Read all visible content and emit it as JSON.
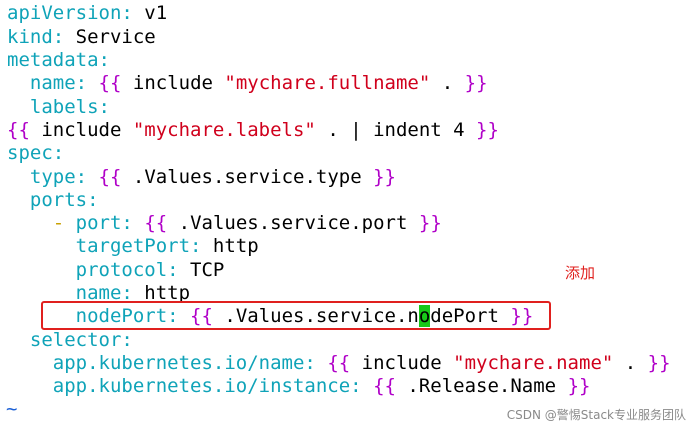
{
  "code": {
    "l1": {
      "k": "apiVersion:",
      "v": " v1"
    },
    "l2": {
      "k": "kind:",
      "v": " Service"
    },
    "l3": {
      "k": "metadata:"
    },
    "l4": {
      "k": "name:",
      "b1": "{{",
      "mid": " include ",
      "s": "\"mychare.fullname\"",
      "tail": " . ",
      "b2": "}}"
    },
    "l5": {
      "k": "labels:"
    },
    "l6": {
      "b1": "{{",
      "mid": " include ",
      "s": "\"mychare.labels\"",
      "tail": " . | indent 4 ",
      "b2": "}}"
    },
    "l7": {
      "k": "spec:"
    },
    "l8": {
      "k": "type:",
      "b1": "{{",
      "mid": " .Values.service.type ",
      "b2": "}}"
    },
    "l9": {
      "k": "ports:"
    },
    "l10": {
      "d": "- ",
      "k": "port:",
      "b1": "{{",
      "mid": " .Values.service.port ",
      "b2": "}}"
    },
    "l11": {
      "k": "targetPort:",
      "v": " http"
    },
    "l12": {
      "k": "protocol:",
      "v": " TCP"
    },
    "l13": {
      "k": "name:",
      "v": " http"
    },
    "l14": {
      "k": "nodePort:",
      "b1": "{{",
      "mid1": " .Values.service.n",
      "cur": "o",
      "mid2": "dePort ",
      "b2": "}}"
    },
    "l15": {
      "k": "selector:"
    },
    "l16": {
      "k": "app.kubernetes.io/name:",
      "b1": "{{",
      "mid": " include ",
      "s": "\"mychare.name\"",
      "tail": " . ",
      "b2": "}}"
    },
    "l17": {
      "k": "app.kubernetes.io/instance:",
      "b1": "{{",
      "mid": " .Release.Name ",
      "b2": "}}"
    },
    "tilde": "~"
  },
  "annotation": "添加",
  "watermark": "CSDN @警惕Stack专业服务团队",
  "colors": {
    "key": "#0fa3b8",
    "brace": "#b000c8",
    "string": "#d0001c",
    "cursor": "#18c818",
    "highlight_border": "#e0201e"
  }
}
